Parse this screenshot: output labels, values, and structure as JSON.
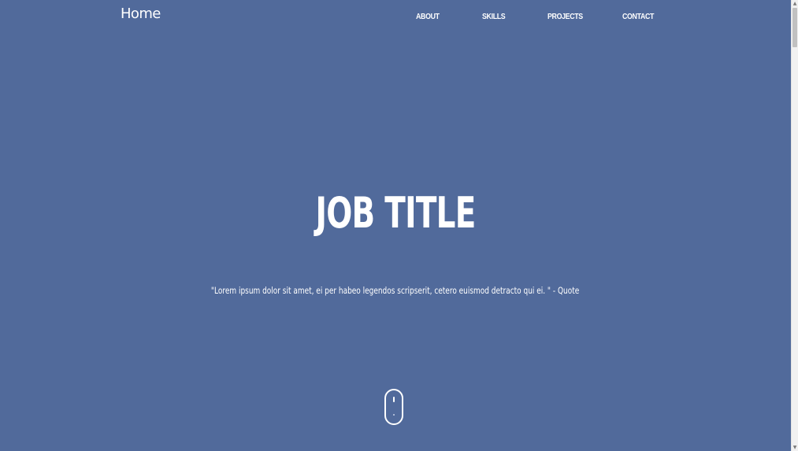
{
  "header": {
    "brand": "Home",
    "nav": [
      {
        "label": "ABOUT"
      },
      {
        "label": "SKILLS"
      },
      {
        "label": "PROJECTS"
      },
      {
        "label": "CONTACT"
      }
    ]
  },
  "hero": {
    "title": "JOB TITLE",
    "quote": "\"Lorem ipsum dolor sit amet, ei per habeo legendos scripserit, cetero euismod detracto qui ei. \" - Quote",
    "scroll_icon": "mouse-scroll-icon"
  },
  "scrollbar": {
    "up_icon": "triangle-up",
    "down_icon": "triangle-down"
  },
  "colors": {
    "background": "#516a9b",
    "text": "#ffffff",
    "scrollbar_track": "#f1f1f1",
    "scrollbar_thumb": "#c1c1c1"
  }
}
